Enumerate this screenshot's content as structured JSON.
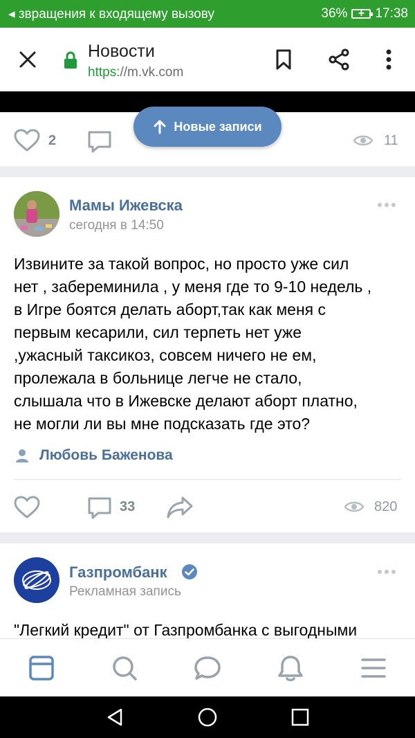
{
  "status_bar": {
    "notification": "звращения к входящему вызову",
    "battery": "36%",
    "time": "17:38"
  },
  "browser": {
    "title": "Новости",
    "url_scheme": "https",
    "url_rest": "://m.vk.com"
  },
  "new_posts_label": "Новые записи",
  "prev_post": {
    "likes": "2",
    "views": "11"
  },
  "post1": {
    "author": "Мамы Ижевска",
    "time": "сегодня в 14:50",
    "text": "Извините за такой вопрос, но просто уже сил\nнет , забереминила , у меня где то 9-10 недель ,\nв Игре боятся делать аборт,так как меня с\nпервым кесарили, сил терпеть нет уже\n,ужасный таксикоз, совсем ничего не ем,\nпролежала в больнице легче не стало,\nслышала что в Ижевске делают аборт платно,\nне могли ли вы мне подсказать где это?",
    "signer": "Любовь Баженова",
    "comments": "33",
    "views": "820"
  },
  "post2": {
    "author": "Газпромбанк",
    "subtitle": "Рекламная запись",
    "text": "\"Легкий кредит\" от Газпромбанка с выгодными"
  },
  "colors": {
    "status_green": "#2e9e2e",
    "vk_blue": "#5b88bf",
    "link_blue": "#4a6f99"
  }
}
